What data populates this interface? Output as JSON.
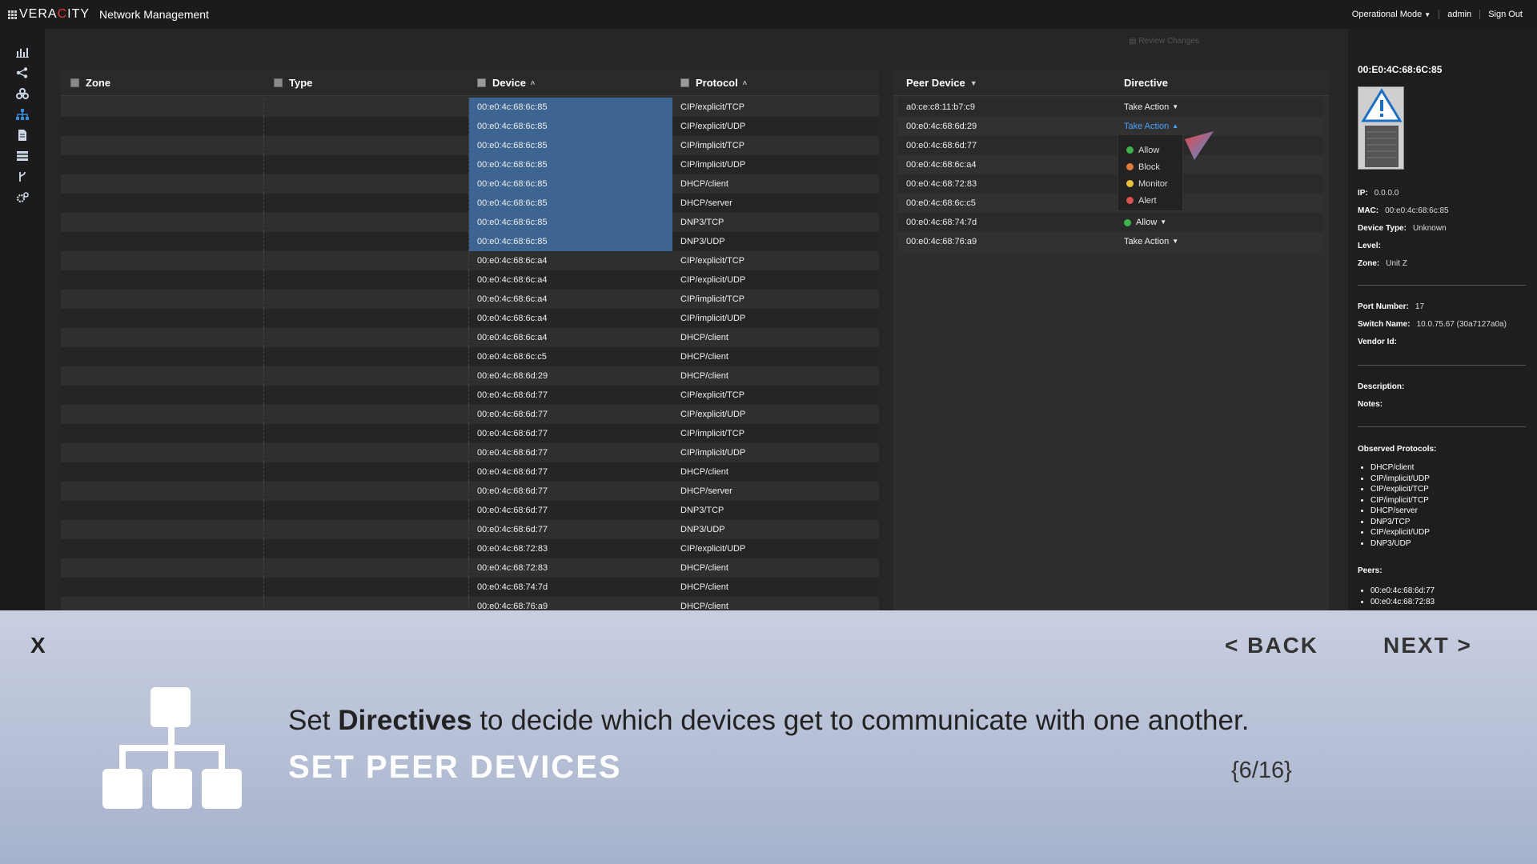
{
  "header": {
    "logo_prefix": "VERA",
    "logo_red": "C",
    "logo_suffix": "ITY",
    "app_title": "Network Management",
    "mode": "Operational Mode",
    "user": "admin",
    "sign_out": "Sign Out"
  },
  "sidebar": {
    "icons": [
      "chart-icon",
      "share-icon",
      "biohazard-icon",
      "network-icon",
      "document-icon",
      "list-icon",
      "fork-icon",
      "settings-icon"
    ],
    "active": "network-icon"
  },
  "review_changes": "Review Changes",
  "table": {
    "columns": {
      "zone": "Zone",
      "type": "Type",
      "device": "Device",
      "protocol": "Protocol"
    },
    "rows": [
      {
        "device": "00:e0:4c:68:6c:85",
        "protocol": "CIP/explicit/TCP",
        "selected": true
      },
      {
        "device": "00:e0:4c:68:6c:85",
        "protocol": "CIP/explicit/UDP",
        "selected": true
      },
      {
        "device": "00:e0:4c:68:6c:85",
        "protocol": "CIP/implicit/TCP",
        "selected": true
      },
      {
        "device": "00:e0:4c:68:6c:85",
        "protocol": "CIP/implicit/UDP",
        "selected": true
      },
      {
        "device": "00:e0:4c:68:6c:85",
        "protocol": "DHCP/client",
        "selected": true
      },
      {
        "device": "00:e0:4c:68:6c:85",
        "protocol": "DHCP/server",
        "selected": true
      },
      {
        "device": "00:e0:4c:68:6c:85",
        "protocol": "DNP3/TCP",
        "selected": true
      },
      {
        "device": "00:e0:4c:68:6c:85",
        "protocol": "DNP3/UDP",
        "selected": true
      },
      {
        "device": "00:e0:4c:68:6c:a4",
        "protocol": "CIP/explicit/TCP",
        "selected": false
      },
      {
        "device": "00:e0:4c:68:6c:a4",
        "protocol": "CIP/explicit/UDP",
        "selected": false
      },
      {
        "device": "00:e0:4c:68:6c:a4",
        "protocol": "CIP/implicit/TCP",
        "selected": false
      },
      {
        "device": "00:e0:4c:68:6c:a4",
        "protocol": "CIP/implicit/UDP",
        "selected": false
      },
      {
        "device": "00:e0:4c:68:6c:a4",
        "protocol": "DHCP/client",
        "selected": false
      },
      {
        "device": "00:e0:4c:68:6c:c5",
        "protocol": "DHCP/client",
        "selected": false
      },
      {
        "device": "00:e0:4c:68:6d:29",
        "protocol": "DHCP/client",
        "selected": false
      },
      {
        "device": "00:e0:4c:68:6d:77",
        "protocol": "CIP/explicit/TCP",
        "selected": false
      },
      {
        "device": "00:e0:4c:68:6d:77",
        "protocol": "CIP/explicit/UDP",
        "selected": false
      },
      {
        "device": "00:e0:4c:68:6d:77",
        "protocol": "CIP/implicit/TCP",
        "selected": false
      },
      {
        "device": "00:e0:4c:68:6d:77",
        "protocol": "CIP/implicit/UDP",
        "selected": false
      },
      {
        "device": "00:e0:4c:68:6d:77",
        "protocol": "DHCP/client",
        "selected": false
      },
      {
        "device": "00:e0:4c:68:6d:77",
        "protocol": "DHCP/server",
        "selected": false
      },
      {
        "device": "00:e0:4c:68:6d:77",
        "protocol": "DNP3/TCP",
        "selected": false
      },
      {
        "device": "00:e0:4c:68:6d:77",
        "protocol": "DNP3/UDP",
        "selected": false
      },
      {
        "device": "00:e0:4c:68:72:83",
        "protocol": "CIP/explicit/UDP",
        "selected": false
      },
      {
        "device": "00:e0:4c:68:72:83",
        "protocol": "DHCP/client",
        "selected": false
      },
      {
        "device": "00:e0:4c:68:74:7d",
        "protocol": "DHCP/client",
        "selected": false
      },
      {
        "device": "00:e0:4c:68:76:a9",
        "protocol": "DHCP/client",
        "selected": false
      }
    ]
  },
  "peers": {
    "columns": {
      "peer": "Peer Device",
      "directive": "Directive"
    },
    "rows": [
      {
        "peer": "a0:ce:c8:11:b7:c9",
        "directive": "Take Action",
        "status": "none"
      },
      {
        "peer": "00:e0:4c:68:6d:29",
        "directive": "Take Action",
        "status": "open"
      },
      {
        "peer": "00:e0:4c:68:6d:77",
        "directive": "",
        "status": "none"
      },
      {
        "peer": "00:e0:4c:68:6c:a4",
        "directive": "",
        "status": "none"
      },
      {
        "peer": "00:e0:4c:68:72:83",
        "directive": "",
        "status": "none"
      },
      {
        "peer": "00:e0:4c:68:6c:c5",
        "directive": "",
        "status": "none"
      },
      {
        "peer": "00:e0:4c:68:74:7d",
        "directive": "Allow",
        "status": "allow"
      },
      {
        "peer": "00:e0:4c:68:76:a9",
        "directive": "Take Action",
        "status": "none"
      }
    ],
    "menu": [
      {
        "label": "Allow",
        "color": "#3cb44b"
      },
      {
        "label": "Block",
        "color": "#e07b39"
      },
      {
        "label": "Monitor",
        "color": "#e8c13a"
      },
      {
        "label": "Alert",
        "color": "#d9534f"
      }
    ]
  },
  "details": {
    "title": "00:E0:4C:68:6C:85",
    "ip_label": "IP:",
    "ip": "0.0.0.0",
    "mac_label": "MAC:",
    "mac": "00:e0:4c:68:6c:85",
    "type_label": "Device Type:",
    "type": "Unknown",
    "level_label": "Level:",
    "zone_label": "Zone:",
    "zone": "Unit Z",
    "port_label": "Port Number:",
    "port": "17",
    "switch_label": "Switch Name:",
    "switch": "10.0.75.67 (30a7127a0a)",
    "vendor_label": "Vendor Id:",
    "description_label": "Description:",
    "notes_label": "Notes:",
    "protocols_label": "Observed Protocols:",
    "protocols": [
      "DHCP/client",
      "CIP/implicit/UDP",
      "CIP/explicit/TCP",
      "CIP/implicit/TCP",
      "DHCP/server",
      "DNP3/TCP",
      "CIP/explicit/UDP",
      "DNP3/UDP"
    ],
    "peers_label": "Peers:",
    "peers": [
      "00:e0:4c:68:6d:77",
      "00:e0:4c:68:72:83"
    ]
  },
  "tour": {
    "close": "X",
    "back": "< BACK",
    "next": "NEXT >",
    "msg_pre": "Set ",
    "msg_bold": "Directives",
    "msg_post": " to decide which devices get to communicate with one another.",
    "title": "SET PEER DEVICES",
    "counter": "{6/16}"
  }
}
